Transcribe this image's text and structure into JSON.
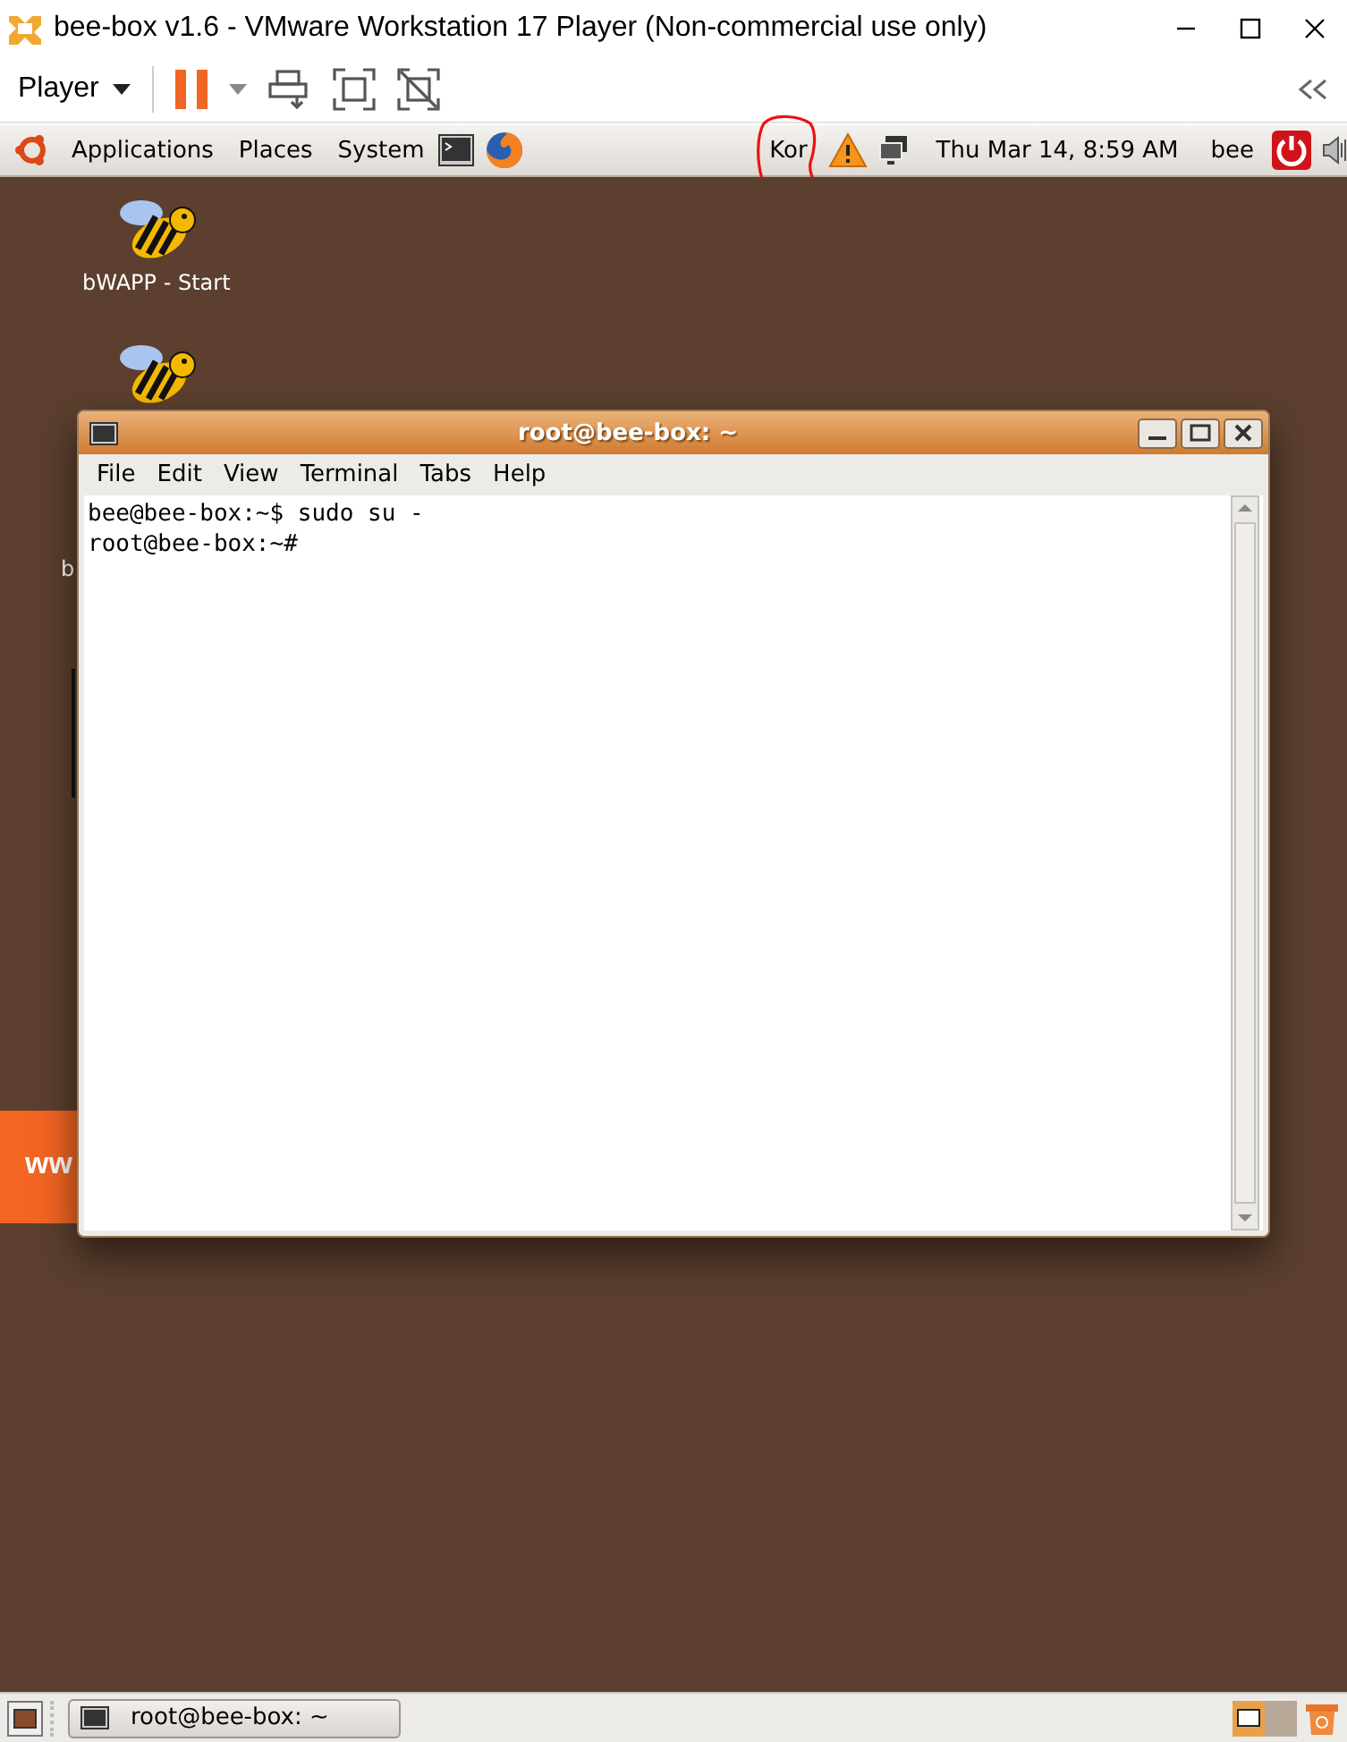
{
  "app_window": {
    "title": "bee-box v1.6 - VMware Workstation 17 Player (Non-commercial use only)"
  },
  "toolbar": {
    "player_menu": "Player"
  },
  "top_panel": {
    "menus": [
      "Applications",
      "Places",
      "System"
    ],
    "keyboard_layout": "Kor",
    "clock": "Thu Mar 14,  8:59 AM",
    "user": "bee"
  },
  "desktop": {
    "icon_label": "bWAPP - Start",
    "cut_label": "b",
    "banner_text": "ww"
  },
  "terminal": {
    "title": "root@bee-box: ~",
    "menus": [
      "File",
      "Edit",
      "View",
      "Terminal",
      "Tabs",
      "Help"
    ],
    "lines": [
      "bee@bee-box:~$ sudo su -",
      "root@bee-box:~#"
    ]
  },
  "taskbar": {
    "tasks": [
      "root@bee-box: ~"
    ]
  }
}
